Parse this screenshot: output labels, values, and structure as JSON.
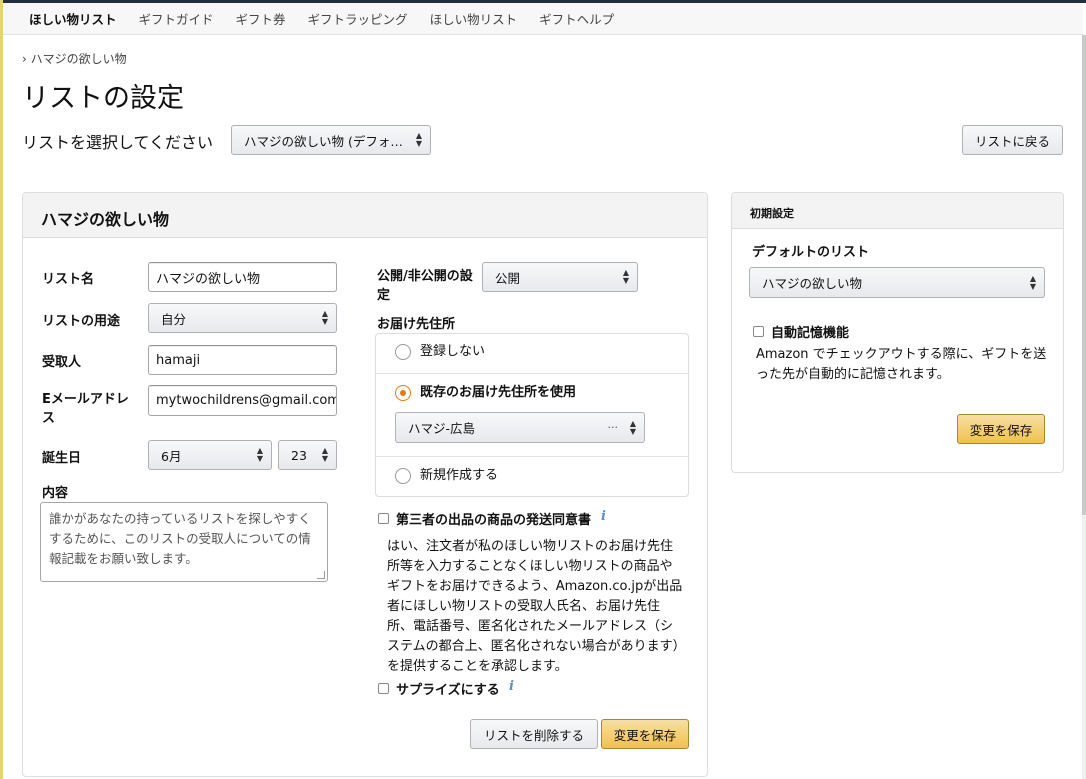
{
  "nav": [
    "ほしい物リスト",
    "ギフトガイド",
    "ギフト券",
    "ギフトラッピング",
    "ほしい物リスト",
    "ギフトヘルプ"
  ],
  "breadcrumb": "› ハマジの欲しい物",
  "page_title": "リストの設定",
  "list_select": {
    "label": "リストを選択してください",
    "value": "ハマジの欲しい物 (デフォ…"
  },
  "back_button": "リストに戻る",
  "main_panel": {
    "title": "ハマジの欲しい物",
    "fields": {
      "list_name": {
        "label": "リスト名",
        "value": "ハマジの欲しい物"
      },
      "purpose": {
        "label": "リストの用途",
        "value": "自分"
      },
      "recipient": {
        "label": "受取人",
        "value": "hamaji"
      },
      "email": {
        "label": "Eメールアドレス",
        "value": "mytwochildrens@gmail.com"
      },
      "birthday": {
        "label": "誕生日",
        "month": "6月",
        "day": "23"
      },
      "description": {
        "label": "内容",
        "value": "誰かがあなたの持っているリストを探しやすくするために、このリストの受取人についての情報記載をお願い致します。"
      }
    },
    "visibility": {
      "label": "公開/非公開の設定",
      "value": "公開"
    },
    "address": {
      "label": "お届け先住所",
      "options": [
        "登録しない",
        "既存のお届け先住所を使用",
        "新規作成する"
      ],
      "selected_address": "ハマジ-広島"
    },
    "third_party": {
      "label": "第三者の出品の商品の発送同意書",
      "description": "はい、注文者が私のほしい物リストのお届け先住所等を入力することなくほしい物リストの商品やギフトをお届けできるよう、Amazon.co.jpが出品者にほしい物リストの受取人氏名、お届け先住所、電話番号、匿名化されたメールアドレス（システムの都合上、匿名化されない場合があります）を提供することを承認します。"
    },
    "surprise": {
      "label": "サプライズにする"
    },
    "delete_button": "リストを削除する",
    "save_button": "変更を保存"
  },
  "defaults_panel": {
    "title": "初期設定",
    "default_list_label": "デフォルトのリスト",
    "default_list_value": "ハマジの欲しい物",
    "auto_remember": {
      "label": "自動記憶機能",
      "description": "Amazon でチェックアウトする際に、ギフトを送った先が自動的に記憶されます。"
    },
    "save_button": "変更を保存"
  },
  "info_glyph": "i",
  "caret_glyph": "▲▼",
  "ellipsis_glyph": "···"
}
